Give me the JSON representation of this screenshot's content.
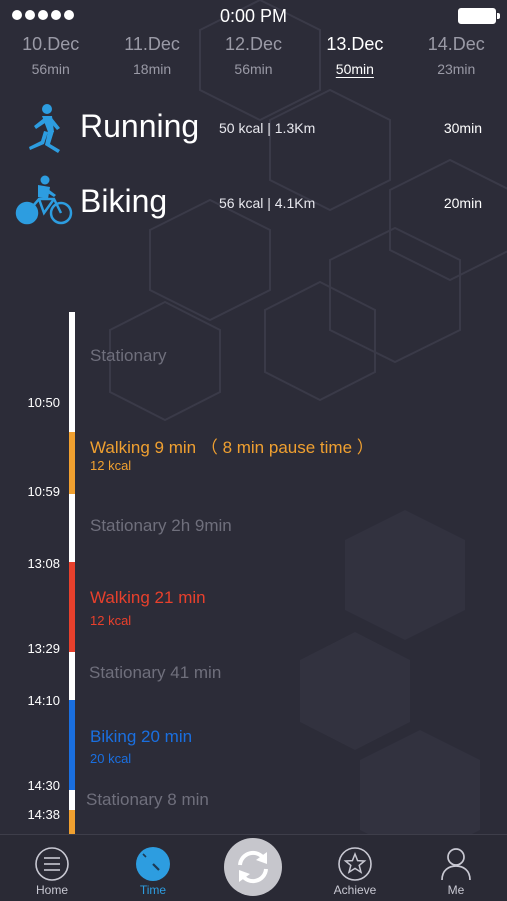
{
  "status_bar": {
    "time": "0:00 PM"
  },
  "dates": [
    {
      "date": "10.Dec",
      "duration": "56min"
    },
    {
      "date": "11.Dec",
      "duration": "18min"
    },
    {
      "date": "12.Dec",
      "duration": "56min"
    },
    {
      "date": "13.Dec",
      "duration": "50min",
      "selected": true
    },
    {
      "date": "14.Dec",
      "duration": "23min"
    }
  ],
  "summary": [
    {
      "name": "Running",
      "stats": "50 kcal | 1.3Km",
      "duration": "30min",
      "icon": "running-icon"
    },
    {
      "name": "Biking",
      "stats": "56 kcal | 4.1Km",
      "duration": "20min",
      "icon": "biking-icon"
    }
  ],
  "timeline": {
    "times": [
      "10:50",
      "10:59",
      "13:08",
      "13:29",
      "14:10",
      "14:30",
      "14:38"
    ],
    "entries": [
      {
        "label": "Stationary",
        "type": "stationary"
      },
      {
        "label": "Walking 9 min （ 8 min pause time ）",
        "sub": "12 kcal",
        "type": "walking-paused"
      },
      {
        "label": "Stationary 2h 9min",
        "type": "stationary"
      },
      {
        "label": "Walking 21 min",
        "sub": "12 kcal",
        "type": "walking"
      },
      {
        "label": "Stationary 41 min",
        "type": "stationary"
      },
      {
        "label": "Biking 20 min",
        "sub": "20 kcal",
        "type": "biking"
      },
      {
        "label": "Stationary 8 min",
        "type": "stationary"
      }
    ]
  },
  "tabs": {
    "home": "Home",
    "time": "Time",
    "achieve": "Achieve",
    "me": "Me",
    "active": "Time"
  },
  "colors": {
    "background": "#2c2c38",
    "walking_paused": "#f0a030",
    "walking": "#e8402c",
    "biking": "#1a6fe0",
    "stationary": "#ffffff",
    "accent": "#2d9de0"
  }
}
